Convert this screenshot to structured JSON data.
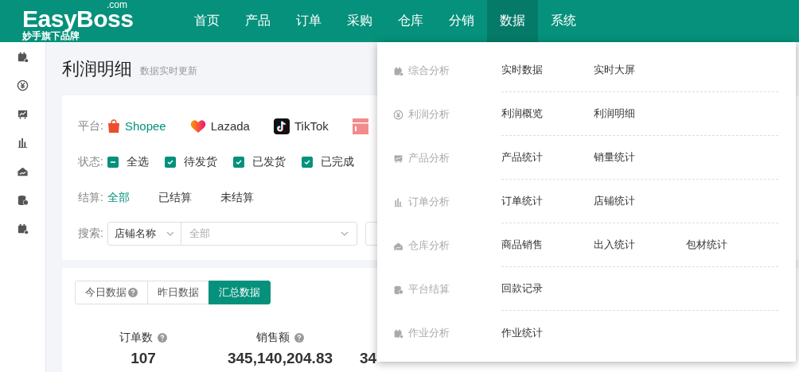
{
  "logo": {
    "name": "EasyBoss",
    "suffix": ".com",
    "tagline": "妙手旗下品牌"
  },
  "nav": [
    {
      "label": "首页",
      "selected": false
    },
    {
      "label": "产品",
      "selected": false
    },
    {
      "label": "订单",
      "selected": false
    },
    {
      "label": "采购",
      "selected": false
    },
    {
      "label": "仓库",
      "selected": false
    },
    {
      "label": "分销",
      "selected": false
    },
    {
      "label": "数据",
      "selected": true
    },
    {
      "label": "系统",
      "selected": false
    }
  ],
  "sidebar": [
    {
      "kind": "calendar"
    },
    {
      "kind": "yen"
    },
    {
      "kind": "board"
    },
    {
      "kind": "bars"
    },
    {
      "kind": "house"
    },
    {
      "kind": "coins"
    },
    {
      "kind": "calendar"
    }
  ],
  "page": {
    "title": "利润明细",
    "subtitle": "数据实时更新"
  },
  "filters": {
    "platform_label": "平台:",
    "platforms": [
      {
        "name": "Shopee",
        "kind": "shopee",
        "selected": true
      },
      {
        "name": "Lazada",
        "kind": "lazada",
        "selected": false
      },
      {
        "name": "TikTok",
        "kind": "tiktok",
        "selected": false
      },
      {
        "kind": "shop"
      }
    ],
    "status_label": "状态:",
    "statuses": [
      {
        "label": "全选",
        "indeterminate": true
      },
      {
        "label": "待发货",
        "checked": true
      },
      {
        "label": "已发货",
        "checked": true
      },
      {
        "label": "已完成",
        "checked": true
      }
    ],
    "settle_label": "结算:",
    "settles": [
      {
        "label": "全部",
        "selected": true
      },
      {
        "label": "已结算",
        "selected": false
      },
      {
        "label": "未结算",
        "selected": false
      }
    ],
    "search_label": "搜索:",
    "search_type": "店铺名称",
    "search_placeholder": "全部"
  },
  "data_tabs": [
    {
      "label": "今日数据",
      "help": true,
      "selected": false
    },
    {
      "label": "昨日数据",
      "help": false,
      "selected": false
    },
    {
      "label": "汇总数据",
      "help": false,
      "selected": true
    }
  ],
  "stats": [
    {
      "label": "订单数",
      "value": "107"
    },
    {
      "label": "销售额",
      "value": "345,140,204.83"
    },
    {
      "value": "34"
    }
  ],
  "menu": [
    {
      "kind": "calendar",
      "title": "综合分析",
      "links": [
        "实时数据",
        "实时大屏"
      ]
    },
    {
      "kind": "yen",
      "title": "利润分析",
      "links": [
        "利润概览",
        "利润明细"
      ]
    },
    {
      "kind": "board",
      "title": "产品分析",
      "links": [
        "产品统计",
        "销量统计"
      ]
    },
    {
      "kind": "bars",
      "title": "订单分析",
      "links": [
        "订单统计",
        "店铺统计"
      ]
    },
    {
      "kind": "house",
      "title": "仓库分析",
      "links": [
        "商品销售",
        "出入统计",
        "包材统计"
      ]
    },
    {
      "kind": "coins",
      "title": "平台结算",
      "links": [
        "回款记录"
      ]
    },
    {
      "kind": "calendar",
      "title": "作业分析",
      "links": [
        "作业统计"
      ]
    }
  ]
}
